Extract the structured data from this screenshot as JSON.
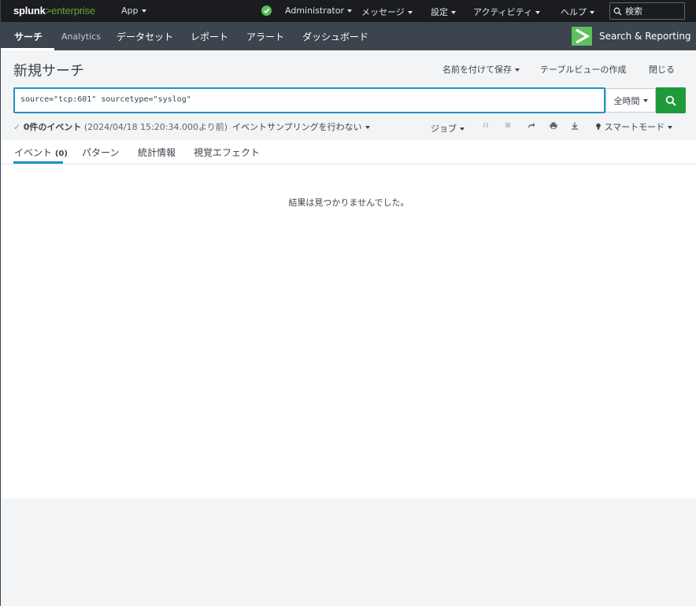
{
  "topbar": {
    "logo_splunk": "splunk",
    "logo_gt": ">",
    "logo_enterprise": "enterprise",
    "app_menu": "App",
    "user_menu": "Administrator",
    "messages_menu": "メッセージ",
    "settings_menu": "設定",
    "activity_menu": "アクティビティ",
    "help_menu": "ヘルプ",
    "search_placeholder": "検索"
  },
  "appnav": {
    "items": [
      "サーチ",
      "Analytics",
      "データセット",
      "レポート",
      "アラート",
      "ダッシュボード"
    ],
    "app_name": "Search & Reporting"
  },
  "title_row": {
    "title": "新規サーチ",
    "save_as": "名前を付けて保存",
    "create_table_view": "テーブルビューの作成",
    "close": "閉じる"
  },
  "search": {
    "query": "source=\"tcp:601\" sourcetype=\"syslog\"",
    "time_range": "全時間"
  },
  "status": {
    "check": "✓",
    "event_count": "0件のイベント",
    "timestamp": "(2024/04/18 15:20:34.000より前)",
    "sampling": "イベントサンプリングを行わない",
    "job": "ジョブ",
    "mode": "スマートモード"
  },
  "tabs": {
    "events_label": "イベント",
    "events_count": "(0)",
    "patterns": "パターン",
    "statistics": "統計情報",
    "visualization": "視覚エフェクト"
  },
  "results": {
    "message": "結果は見つかりませんでした。"
  },
  "colors": {
    "topbar_bg": "#1a1c20",
    "appnav_bg": "#3c444d",
    "accent_green": "#5cc05c",
    "search_button": "#1f9a3a",
    "focus_blue": "#1e93c6"
  }
}
